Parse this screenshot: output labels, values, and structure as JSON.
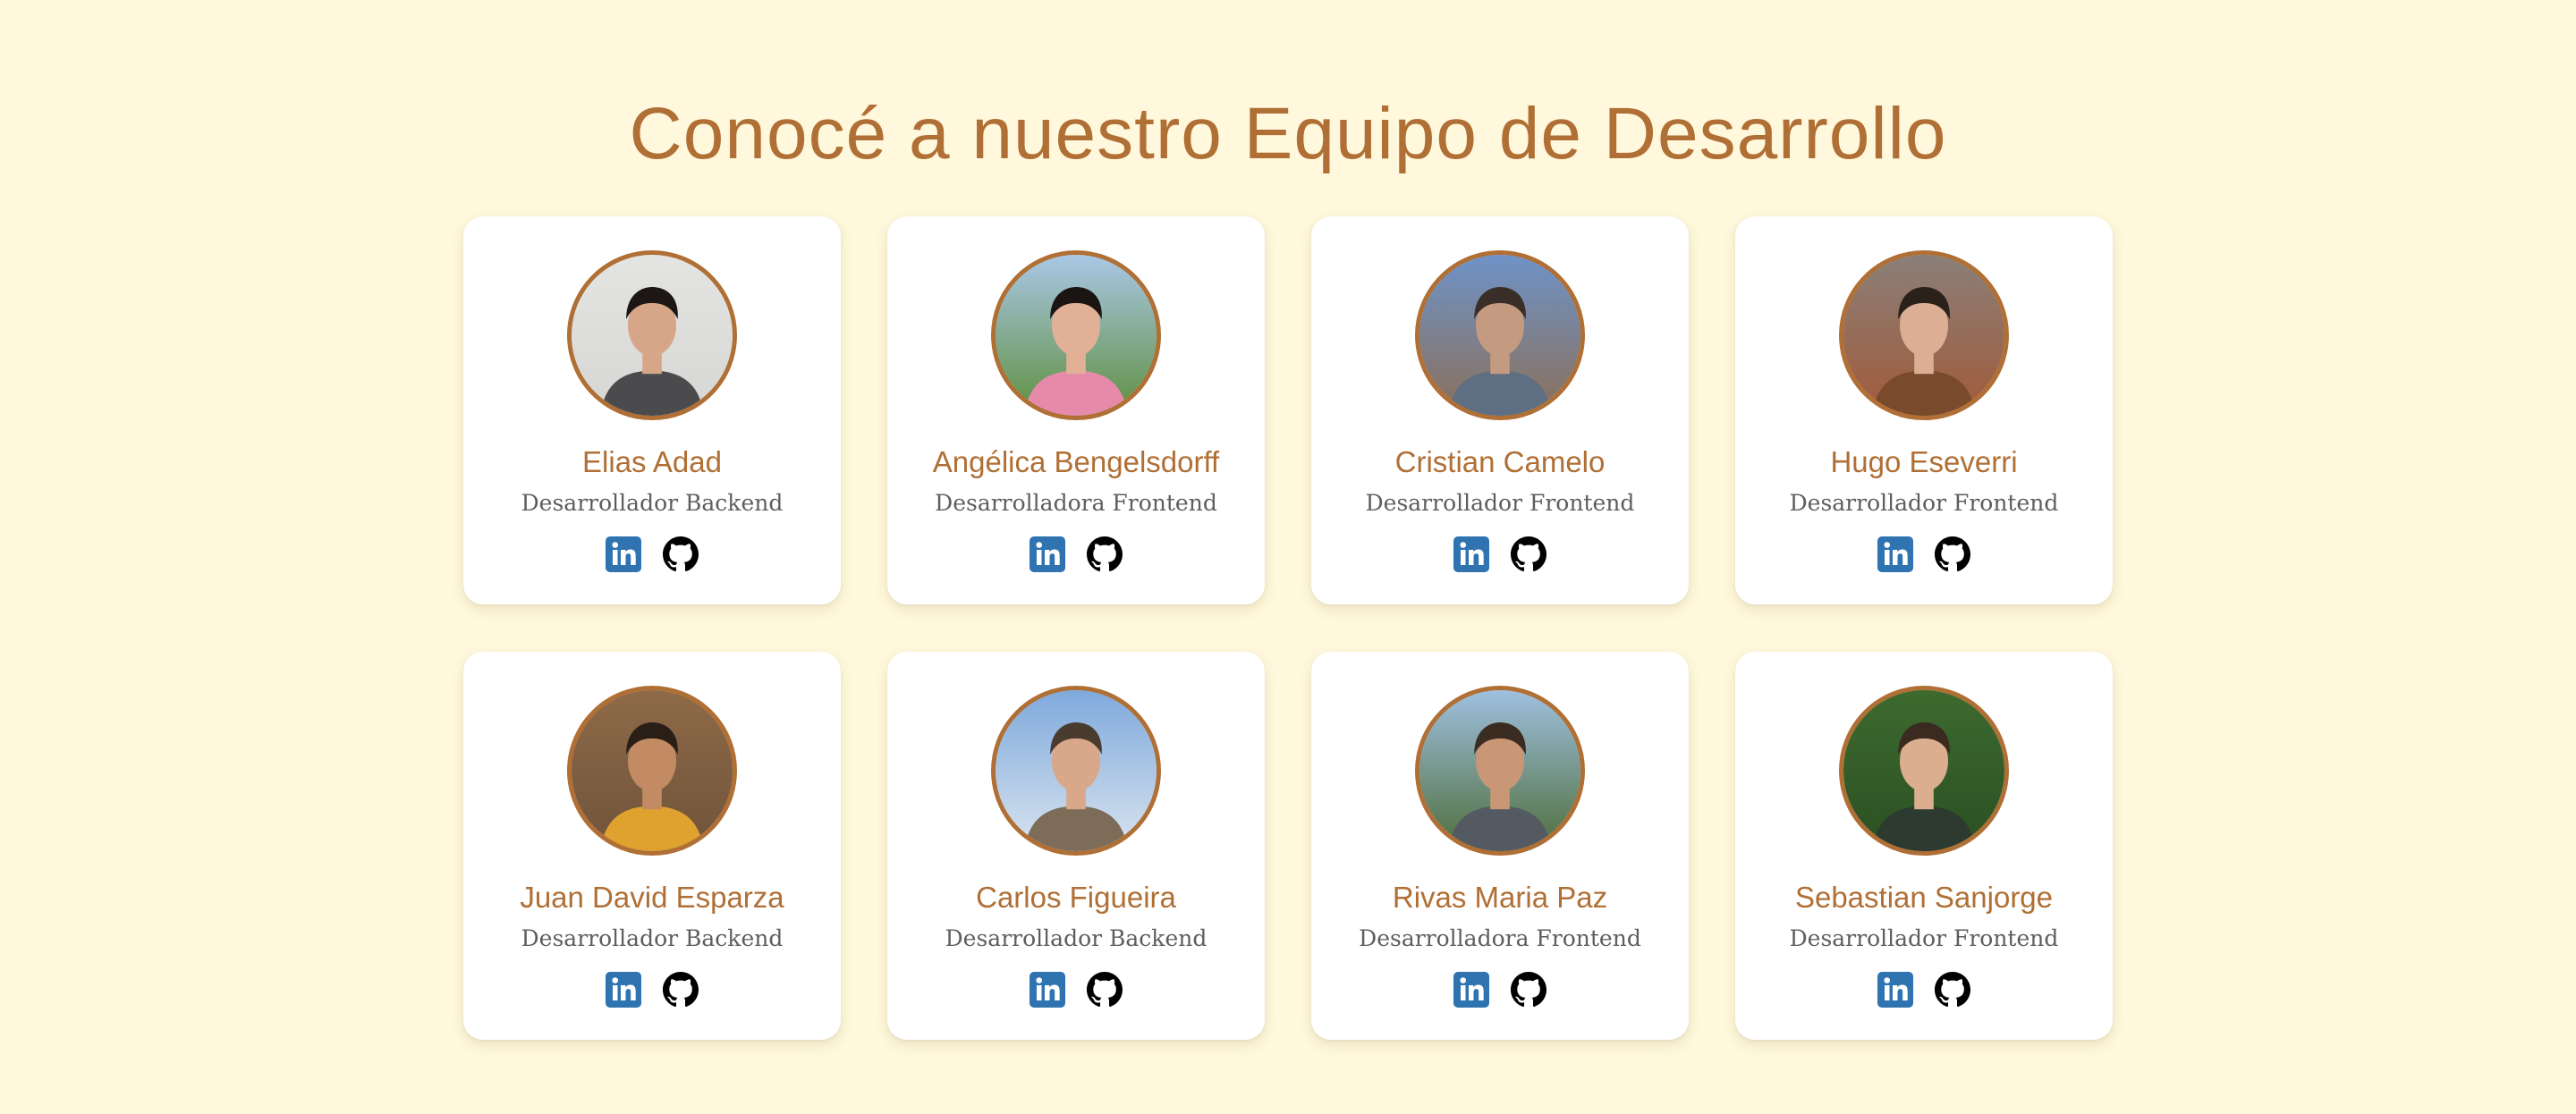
{
  "page": {
    "title": "Conocé a nuestro Equipo de Desarrollo"
  },
  "colors": {
    "background": "#fff8dc",
    "accent": "#b06f35",
    "card": "#ffffff",
    "role_text": "#5e5e5e",
    "linkedin": "#2f73b1",
    "github": "#000000"
  },
  "team": [
    {
      "name": "Elias Adad",
      "role": "Desarrollador Backend",
      "photo": "gray-bg",
      "linkedin_icon": "linkedin-icon",
      "github_icon": "github-icon"
    },
    {
      "name": "Angélica Bengelsdorff",
      "role": "Desarrolladora Frontend",
      "photo": "outdoor",
      "linkedin_icon": "linkedin-icon",
      "github_icon": "github-icon"
    },
    {
      "name": "Cristian Camelo",
      "role": "Desarrollador Frontend",
      "photo": "sky-statue",
      "linkedin_icon": "linkedin-icon",
      "github_icon": "github-icon"
    },
    {
      "name": "Hugo Eseverri",
      "role": "Desarrollador Frontend",
      "photo": "indoor",
      "linkedin_icon": "linkedin-icon",
      "github_icon": "github-icon"
    },
    {
      "name": "Juan David Esparza",
      "role": "Desarrollador Backend",
      "photo": "stone-wall",
      "linkedin_icon": "linkedin-icon",
      "github_icon": "github-icon"
    },
    {
      "name": "Carlos Figueira",
      "role": "Desarrollador Backend",
      "photo": "sky",
      "linkedin_icon": "linkedin-icon",
      "github_icon": "github-icon"
    },
    {
      "name": "Rivas Maria Paz",
      "role": "Desarrolladora Frontend",
      "photo": "waterfall",
      "linkedin_icon": "linkedin-icon",
      "github_icon": "github-icon"
    },
    {
      "name": "Sebastian Sanjorge",
      "role": "Desarrollador Frontend",
      "photo": "foliage",
      "linkedin_icon": "linkedin-icon",
      "github_icon": "github-icon"
    }
  ]
}
